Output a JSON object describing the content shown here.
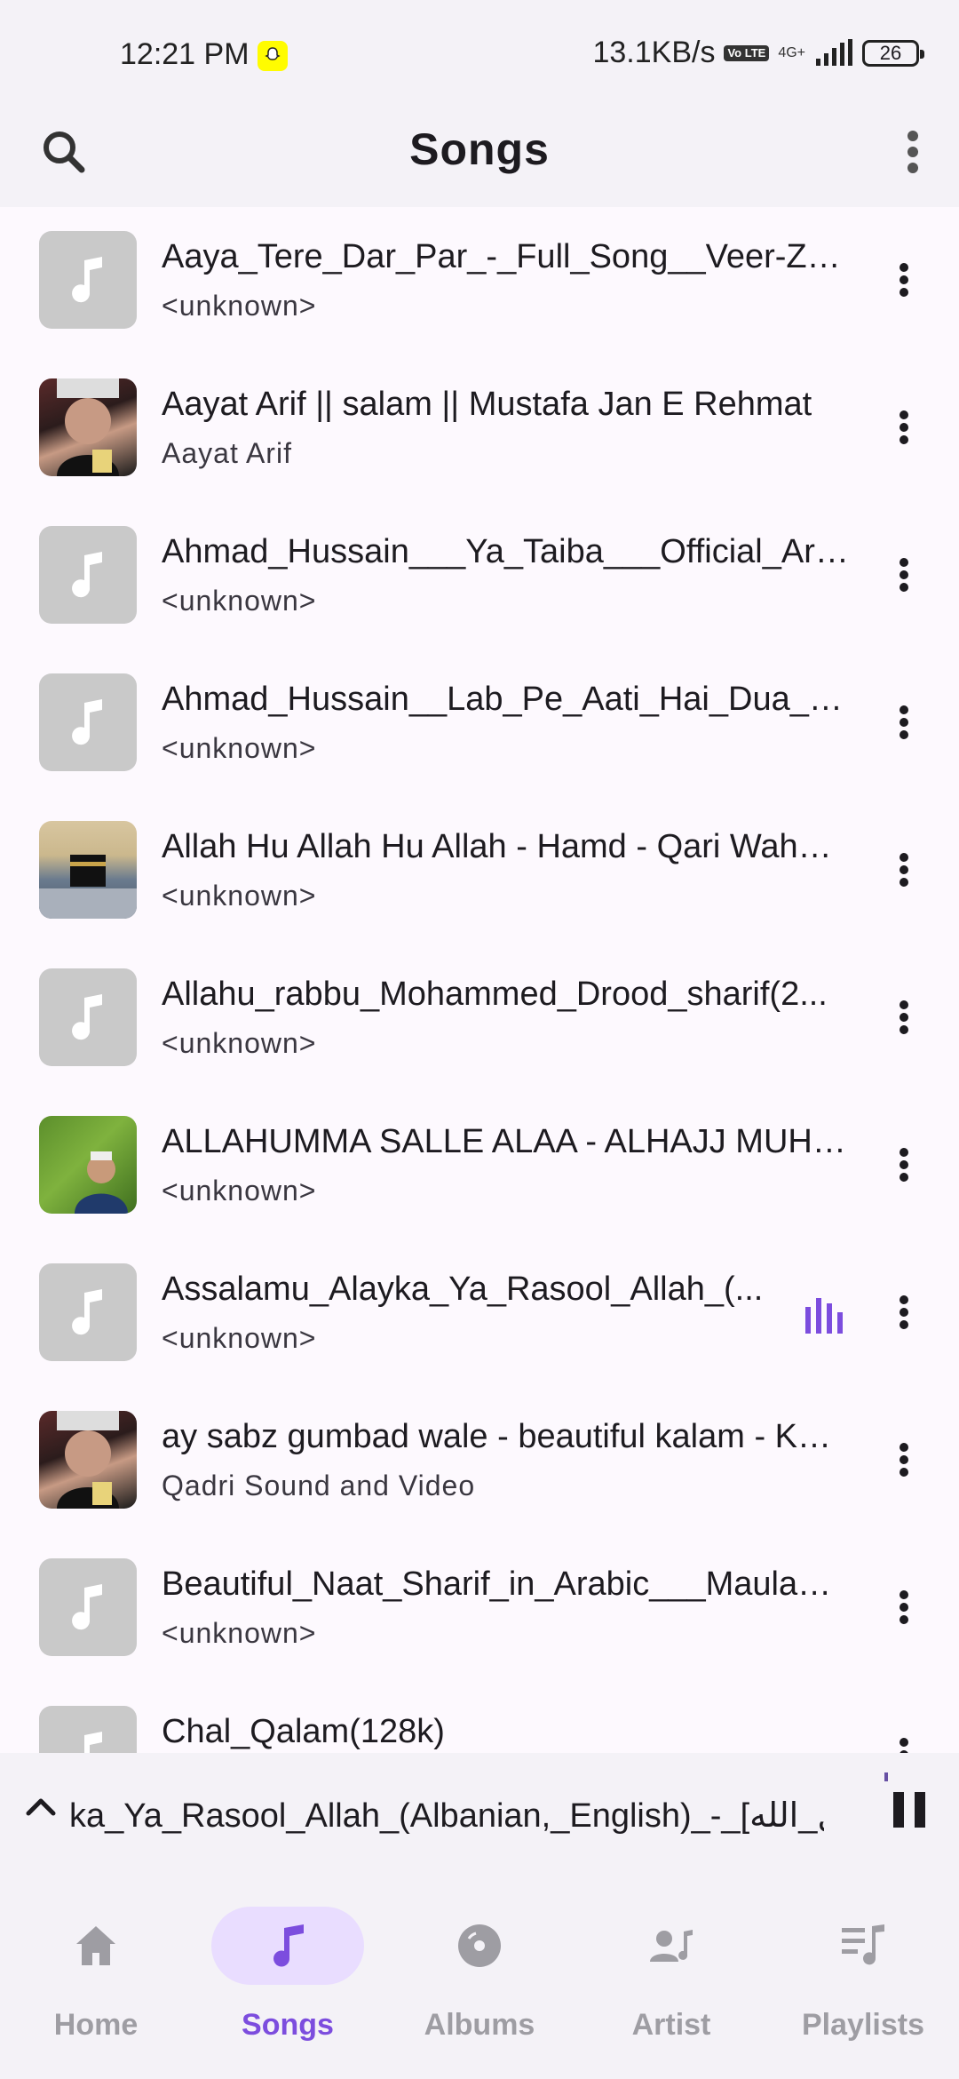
{
  "status_bar": {
    "time": "12:21 PM",
    "net_speed": "13.1KB/s",
    "volte": "Vo LTE",
    "net_type": "4G+",
    "battery": "26"
  },
  "header": {
    "title": "Songs",
    "search_icon": "search-icon",
    "menu_icon": "more-vert-icon"
  },
  "songs": [
    {
      "title": "Aaya_Tere_Dar_Par_-_Full_Song__Veer-Zara",
      "artist": "<unknown>"
    },
    {
      "title": "Aayat Arif || salam || Mustafa Jan E Rehmat",
      "artist": "Aayat Arif"
    },
    {
      "title": "Ahmad_Hussain___Ya_Taiba___Official_Arabic",
      "artist": "<unknown>"
    },
    {
      "title": "Ahmad_Hussain__Lab_Pe_Aati_Hai_Dua__Official",
      "artist": "<unknown>"
    },
    {
      "title": "Allah Hu Allah Hu Allah - Hamd - Qari Waheed",
      "artist": "<unknown>"
    },
    {
      "title": "Allahu_rabbu_Mohammed_Drood_sharif(2...",
      "artist": "<unknown>"
    },
    {
      "title": "ALLAHUMMA SALLE ALAA - ALHAJJ MUHAMMAD",
      "artist": "<unknown>"
    },
    {
      "title": "Assalamu_Alayka_Ya_Rasool_Allah_(...",
      "artist": "<unknown>"
    },
    {
      "title": "ay sabz gumbad wale - beautiful kalam - Khalid",
      "artist": "Qadri Sound and Video"
    },
    {
      "title": "Beautiful_Naat_Sharif_in_Arabic___Maula_Ya_Salli",
      "artist": "<unknown>"
    },
    {
      "title": "Chal_Qalam(128k)",
      "artist": ""
    }
  ],
  "mini_player": {
    "title": "ka_Ya_Rasool_Allah_(Albanian,_English)_-_[ل_الله"
  },
  "nav": {
    "home": "Home",
    "songs": "Songs",
    "albums": "Albums",
    "artist": "Artist",
    "playlists": "Playlists"
  },
  "colors": {
    "accent": "#7c4dde",
    "accent_container": "#e9ddff",
    "inactive": "#9e9da3",
    "placeholder_thumb": "#c9c9c9"
  }
}
